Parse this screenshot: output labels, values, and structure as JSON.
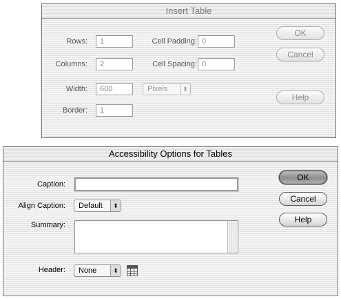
{
  "insert_table": {
    "title": "Insert Table",
    "rows_label": "Rows:",
    "rows_value": "1",
    "columns_label": "Columns:",
    "columns_value": "2",
    "width_label": "Width:",
    "width_value": "600",
    "width_unit": "Pixels",
    "border_label": "Border:",
    "border_value": "1",
    "cell_padding_label": "Cell Padding:",
    "cell_padding_value": "0",
    "cell_spacing_label": "Cell Spacing:",
    "cell_spacing_value": "0",
    "ok_label": "OK",
    "cancel_label": "Cancel",
    "help_label": "Help"
  },
  "accessibility": {
    "title": "Accessibility Options for Tables",
    "caption_label": "Caption:",
    "caption_value": "",
    "align_caption_label": "Align Caption:",
    "align_caption_value": "Default",
    "summary_label": "Summary:",
    "summary_value": "",
    "header_label": "Header:",
    "header_value": "None",
    "header_icon": "table-header-icon",
    "ok_label": "OK",
    "cancel_label": "Cancel",
    "help_label": "Help"
  },
  "icons": {
    "popup_arrows": "updown-arrows-icon"
  }
}
